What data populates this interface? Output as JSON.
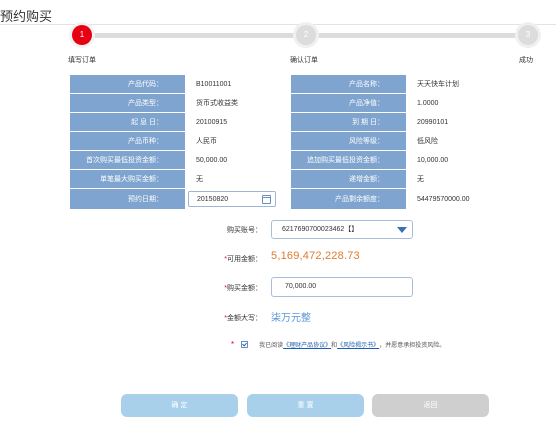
{
  "page": {
    "title": "预约购买"
  },
  "steps": [
    {
      "num": "1",
      "label": "填写订单"
    },
    {
      "num": "2",
      "label": "确认订单"
    },
    {
      "num": "3",
      "label": "成功"
    }
  ],
  "info": {
    "rows": [
      {
        "l1": "产品代码：",
        "v1": "B10011001",
        "l2": "产品名称：",
        "v2": "天天快车计划"
      },
      {
        "l1": "产品类型：",
        "v1": "货币式收益类",
        "l2": "产品净值：",
        "v2": "1.0000"
      },
      {
        "l1": "起 息 日：",
        "v1": "20100915",
        "l2": "到 期 日：",
        "v2": "20990101"
      },
      {
        "l1": "产品币种：",
        "v1": "人民币",
        "l2": "风险等级：",
        "v2": "低风险"
      },
      {
        "l1": "首次购买最低投资金额：",
        "v1": "50,000.00",
        "l2": "追加购买最低投资金额：",
        "v2": "10,000.00"
      },
      {
        "l1": "单笔最大购买金额：",
        "v1": "无",
        "l2": "递增金额：",
        "v2": "无"
      }
    ],
    "reserve_date_label": "预约日期：",
    "reserve_date_value": "20150820",
    "remaining_label": "产品剩余额度：",
    "remaining_value": "54479570000.00"
  },
  "form": {
    "account_label": "购买账号：",
    "account_value": "6217690700023462【】",
    "available_label": "可用金额：",
    "available_value": "5,169,472,228.73",
    "purchase_label": "购买金额：",
    "purchase_value": "70,000.00",
    "amount_cn_label": "金额大写：",
    "amount_cn_value": "柒万元整",
    "agree_prefix": "我已阅读",
    "agree_link1": "《理财产品协议》",
    "agree_mid": "和",
    "agree_link2": "《风险揭示书》",
    "agree_suffix": "，并愿意承担投资风险。",
    "required_mark": "*"
  },
  "buttons": {
    "confirm": "确 定",
    "reset": "重 置",
    "back": "返回"
  },
  "colors": {
    "header_cell": "#7fa4cf",
    "active_step": "#e60012",
    "amount": "#e07b2e",
    "button": "#a9d0ea"
  }
}
